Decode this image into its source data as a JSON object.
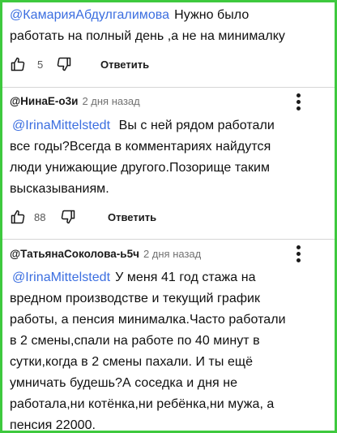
{
  "comments": [
    {
      "mention": "@КамарияАбдулгалимова",
      "text_first": "Нужно было",
      "text_lines": [
        "работать на полный день ,а не на минималку"
      ],
      "likes": "5",
      "reply_label": "Ответить",
      "like_icon": "thumb-up-icon",
      "dislike_icon": "thumb-down-icon"
    },
    {
      "author": "@НинаЕ-о3и",
      "date": "2 дня назад",
      "mention": "@IrinaMittelstedt",
      "text_first": "Вы с ней рядом работали",
      "text_lines": [
        "все годы?Всегда в комментариях найдутся",
        "люди унижающие другого.Позорище таким",
        "высказываниям."
      ],
      "likes": "88",
      "reply_label": "Ответить",
      "menu_icon": "more-vert-icon"
    },
    {
      "author": "@ТатьянаСоколова-ь5ч",
      "date": "2 дня назад",
      "mention": "@IrinaMittelstedt",
      "text_first": "У меня 41 год стажа на",
      "text_lines": [
        "вредном производстве и текущий график",
        "работы, а пенсия минималка.Часто работали",
        "в 2 смены,спали на работе по 40 минут в",
        "сутки,когда в 2 смены пахали. И ты ещё",
        "умничать будешь?А соседка и дня не",
        "работала,ни котёнка,ни ребёнка,ни мужа, а",
        "пенсия 22000."
      ],
      "menu_icon": "more-vert-icon"
    }
  ],
  "colors": {
    "mention": "#3b6ee0",
    "frame": "#3ec93e",
    "separator": "#d6d6d6"
  }
}
